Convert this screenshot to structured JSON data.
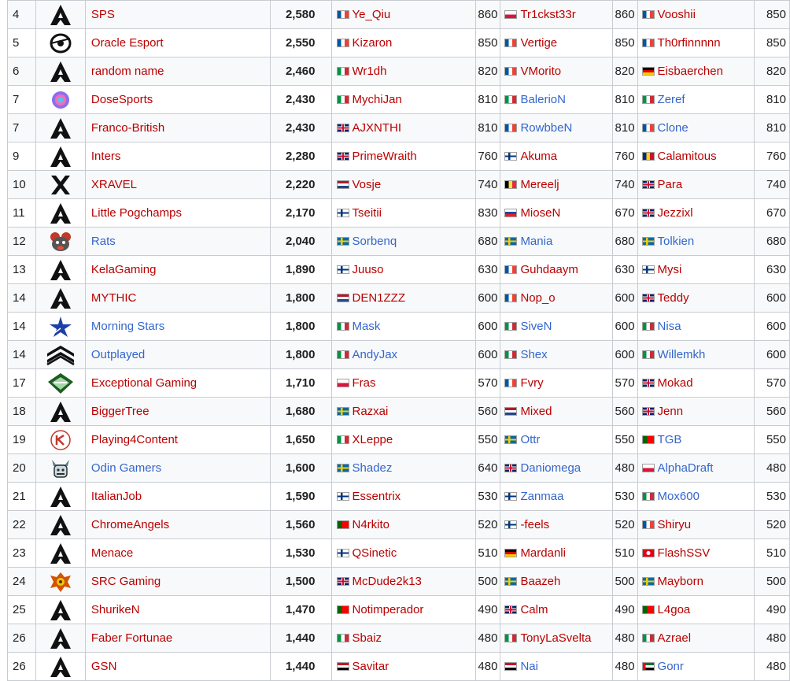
{
  "colors": {
    "link_red": "#ba0000",
    "link_blue": "#3366cc",
    "row_alt": "#f8f9fa",
    "border": "#c8ccd1"
  },
  "rows": [
    {
      "rank": "4",
      "logo": "apex-icon",
      "team": "SPS",
      "team_color": "red",
      "points": "2,580",
      "p1": {
        "flag": "FR",
        "name": "Ye_Qiu",
        "color": "red",
        "pts": "860"
      },
      "p2": {
        "flag": "PL",
        "name": "Tr1ckst33r",
        "color": "red",
        "pts": "860"
      },
      "p3": {
        "flag": "FR",
        "name": "Vooshii",
        "color": "red",
        "pts": "850"
      }
    },
    {
      "rank": "5",
      "logo": "oracle-icon",
      "team": "Oracle Esport",
      "team_color": "red",
      "points": "2,550",
      "p1": {
        "flag": "FR",
        "name": "Kizaron",
        "color": "red",
        "pts": "850"
      },
      "p2": {
        "flag": "FR",
        "name": "Vertige",
        "color": "red",
        "pts": "850"
      },
      "p3": {
        "flag": "FR",
        "name": "Th0rfinnnnn",
        "color": "red",
        "pts": "850"
      }
    },
    {
      "rank": "6",
      "logo": "apex-icon",
      "team": "random name",
      "team_color": "red",
      "points": "2,460",
      "p1": {
        "flag": "IT",
        "name": "Wr1dh",
        "color": "red",
        "pts": "820"
      },
      "p2": {
        "flag": "FR",
        "name": "VMorito",
        "color": "red",
        "pts": "820"
      },
      "p3": {
        "flag": "DE",
        "name": "Eisbaerchen",
        "color": "red",
        "pts": "820"
      }
    },
    {
      "rank": "7",
      "logo": "dosesports-icon",
      "team": "DoseSports",
      "team_color": "red",
      "points": "2,430",
      "p1": {
        "flag": "IT",
        "name": "MychiJan",
        "color": "red",
        "pts": "810"
      },
      "p2": {
        "flag": "IT",
        "name": "BalerioN",
        "color": "blue",
        "pts": "810"
      },
      "p3": {
        "flag": "IT",
        "name": "Zeref",
        "color": "blue",
        "pts": "810"
      }
    },
    {
      "rank": "7",
      "logo": "apex-icon",
      "team": "Franco-British",
      "team_color": "red",
      "points": "2,430",
      "p1": {
        "flag": "GB",
        "name": "AJXNTHI",
        "color": "red",
        "pts": "810"
      },
      "p2": {
        "flag": "FR",
        "name": "RowbbeN",
        "color": "blue",
        "pts": "810"
      },
      "p3": {
        "flag": "FR",
        "name": "Clone",
        "color": "blue",
        "pts": "810"
      }
    },
    {
      "rank": "9",
      "logo": "apex-icon",
      "team": "Inters",
      "team_color": "red",
      "points": "2,280",
      "p1": {
        "flag": "GB",
        "name": "PrimeWraith",
        "color": "red",
        "pts": "760"
      },
      "p2": {
        "flag": "FI",
        "name": "Akuma",
        "color": "red",
        "pts": "760"
      },
      "p3": {
        "flag": "RO",
        "name": "Calamitous",
        "color": "red",
        "pts": "760"
      }
    },
    {
      "rank": "10",
      "logo": "xravel-icon",
      "team": "XRAVEL",
      "team_color": "red",
      "points": "2,220",
      "p1": {
        "flag": "NL",
        "name": "Vosje",
        "color": "red",
        "pts": "740"
      },
      "p2": {
        "flag": "BE",
        "name": "Mereelj",
        "color": "red",
        "pts": "740"
      },
      "p3": {
        "flag": "GB",
        "name": "Para",
        "color": "red",
        "pts": "740"
      }
    },
    {
      "rank": "11",
      "logo": "apex-icon",
      "team": "Little Pogchamps",
      "team_color": "red",
      "points": "2,170",
      "p1": {
        "flag": "FI",
        "name": "Tseitii",
        "color": "red",
        "pts": "830"
      },
      "p2": {
        "flag": "SK",
        "name": "MioseN",
        "color": "red",
        "pts": "670"
      },
      "p3": {
        "flag": "GB",
        "name": "Jezzixl",
        "color": "red",
        "pts": "670"
      }
    },
    {
      "rank": "12",
      "logo": "rats-icon",
      "team": "Rats",
      "team_color": "blue",
      "points": "2,040",
      "p1": {
        "flag": "SE",
        "name": "Sorbenq",
        "color": "blue",
        "pts": "680"
      },
      "p2": {
        "flag": "SE",
        "name": "Mania",
        "color": "blue",
        "pts": "680"
      },
      "p3": {
        "flag": "SE",
        "name": "Tolkien",
        "color": "blue",
        "pts": "680"
      }
    },
    {
      "rank": "13",
      "logo": "apex-icon",
      "team": "KelaGaming",
      "team_color": "red",
      "points": "1,890",
      "p1": {
        "flag": "FI",
        "name": "Juuso",
        "color": "red",
        "pts": "630"
      },
      "p2": {
        "flag": "FR",
        "name": "Guhdaaym",
        "color": "red",
        "pts": "630"
      },
      "p3": {
        "flag": "FI",
        "name": "Mysi",
        "color": "red",
        "pts": "630"
      }
    },
    {
      "rank": "14",
      "logo": "apex-icon",
      "team": "MYTHIC",
      "team_color": "red",
      "points": "1,800",
      "p1": {
        "flag": "NL",
        "name": "DEN1ZZZ",
        "color": "red",
        "pts": "600"
      },
      "p2": {
        "flag": "FR",
        "name": "Nop_o",
        "color": "red",
        "pts": "600"
      },
      "p3": {
        "flag": "GB",
        "name": "Teddy",
        "color": "red",
        "pts": "600"
      }
    },
    {
      "rank": "14",
      "logo": "star-icon",
      "team": "Morning Stars",
      "team_color": "blue",
      "points": "1,800",
      "p1": {
        "flag": "IT",
        "name": "Mask",
        "color": "blue",
        "pts": "600"
      },
      "p2": {
        "flag": "IT",
        "name": "SiveN",
        "color": "blue",
        "pts": "600"
      },
      "p3": {
        "flag": "IT",
        "name": "Nisa",
        "color": "blue",
        "pts": "600"
      }
    },
    {
      "rank": "14",
      "logo": "outplayed-icon",
      "team": "Outplayed",
      "team_color": "blue",
      "points": "1,800",
      "p1": {
        "flag": "IT",
        "name": "AndyJax",
        "color": "blue",
        "pts": "600"
      },
      "p2": {
        "flag": "IT",
        "name": "Shex",
        "color": "blue",
        "pts": "600"
      },
      "p3": {
        "flag": "IT",
        "name": "Willemkh",
        "color": "blue",
        "pts": "600"
      }
    },
    {
      "rank": "17",
      "logo": "exceptional-icon",
      "team": "Exceptional Gaming",
      "team_color": "red",
      "points": "1,710",
      "p1": {
        "flag": "PL",
        "name": "Fras",
        "color": "red",
        "pts": "570"
      },
      "p2": {
        "flag": "FR",
        "name": "Fvry",
        "color": "red",
        "pts": "570"
      },
      "p3": {
        "flag": "GB",
        "name": "Mokad",
        "color": "red",
        "pts": "570"
      }
    },
    {
      "rank": "18",
      "logo": "apex-icon",
      "team": "BiggerTree",
      "team_color": "red",
      "points": "1,680",
      "p1": {
        "flag": "SE",
        "name": "Razxai",
        "color": "red",
        "pts": "560"
      },
      "p2": {
        "flag": "NL",
        "name": "Mixed",
        "color": "red",
        "pts": "560"
      },
      "p3": {
        "flag": "GB",
        "name": "Jenn",
        "color": "red",
        "pts": "560"
      }
    },
    {
      "rank": "19",
      "logo": "playing4content-icon",
      "team": "Playing4Content",
      "team_color": "red",
      "points": "1,650",
      "p1": {
        "flag": "IT",
        "name": "XLeppe",
        "color": "red",
        "pts": "550"
      },
      "p2": {
        "flag": "SE",
        "name": "Ottr",
        "color": "blue",
        "pts": "550"
      },
      "p3": {
        "flag": "PT",
        "name": "TGB",
        "color": "blue",
        "pts": "550"
      }
    },
    {
      "rank": "20",
      "logo": "odin-icon",
      "team": "Odin Gamers",
      "team_color": "blue",
      "points": "1,600",
      "p1": {
        "flag": "SE",
        "name": "Shadez",
        "color": "blue",
        "pts": "640"
      },
      "p2": {
        "flag": "GB",
        "name": "Daniomega",
        "color": "blue",
        "pts": "480"
      },
      "p3": {
        "flag": "PL",
        "name": "AlphaDraft",
        "color": "blue",
        "pts": "480"
      }
    },
    {
      "rank": "21",
      "logo": "apex-icon",
      "team": "ItalianJob",
      "team_color": "red",
      "points": "1,590",
      "p1": {
        "flag": "FI",
        "name": "Essentrix",
        "color": "red",
        "pts": "530"
      },
      "p2": {
        "flag": "FI",
        "name": "Zanmaa",
        "color": "blue",
        "pts": "530"
      },
      "p3": {
        "flag": "IT",
        "name": "Mox600",
        "color": "blue",
        "pts": "530"
      }
    },
    {
      "rank": "22",
      "logo": "apex-icon",
      "team": "ChromeAngels",
      "team_color": "red",
      "points": "1,560",
      "p1": {
        "flag": "PT",
        "name": "N4rkito",
        "color": "red",
        "pts": "520"
      },
      "p2": {
        "flag": "FI",
        "name": "-feels",
        "color": "red",
        "pts": "520"
      },
      "p3": {
        "flag": "FR",
        "name": "Shiryu",
        "color": "red",
        "pts": "520"
      }
    },
    {
      "rank": "23",
      "logo": "apex-icon",
      "team": "Menace",
      "team_color": "red",
      "points": "1,530",
      "p1": {
        "flag": "FI",
        "name": "QSinetic",
        "color": "red",
        "pts": "510"
      },
      "p2": {
        "flag": "DE",
        "name": "Mardanli",
        "color": "red",
        "pts": "510"
      },
      "p3": {
        "flag": "TN",
        "name": "FlashSSV",
        "color": "red",
        "pts": "510"
      }
    },
    {
      "rank": "24",
      "logo": "src-icon",
      "team": "SRC Gaming",
      "team_color": "red",
      "points": "1,500",
      "p1": {
        "flag": "GB",
        "name": "McDude2k13",
        "color": "red",
        "pts": "500"
      },
      "p2": {
        "flag": "SE",
        "name": "Baazeh",
        "color": "red",
        "pts": "500"
      },
      "p3": {
        "flag": "SE",
        "name": "Mayborn",
        "color": "red",
        "pts": "500"
      }
    },
    {
      "rank": "25",
      "logo": "apex-icon",
      "team": "ShurikeN",
      "team_color": "red",
      "points": "1,470",
      "p1": {
        "flag": "PT",
        "name": "Notimperador",
        "color": "red",
        "pts": "490"
      },
      "p2": {
        "flag": "GB",
        "name": "Calm",
        "color": "red",
        "pts": "490"
      },
      "p3": {
        "flag": "PT",
        "name": "L4goa",
        "color": "red",
        "pts": "490"
      }
    },
    {
      "rank": "26",
      "logo": "apex-icon",
      "team": "Faber Fortunae",
      "team_color": "red",
      "points": "1,440",
      "p1": {
        "flag": "IT",
        "name": "Sbaiz",
        "color": "red",
        "pts": "480"
      },
      "p2": {
        "flag": "IT",
        "name": "TonyLaSvelta",
        "color": "red",
        "pts": "480"
      },
      "p3": {
        "flag": "IT",
        "name": "Azrael",
        "color": "red",
        "pts": "480"
      }
    },
    {
      "rank": "26",
      "logo": "apex-icon",
      "team": "GSN",
      "team_color": "red",
      "points": "1,440",
      "p1": {
        "flag": "EG",
        "name": "Savitar",
        "color": "red",
        "pts": "480"
      },
      "p2": {
        "flag": "EG",
        "name": "Nai",
        "color": "blue",
        "pts": "480"
      },
      "p3": {
        "flag": "AE",
        "name": "Gonr",
        "color": "blue",
        "pts": "480"
      }
    }
  ]
}
